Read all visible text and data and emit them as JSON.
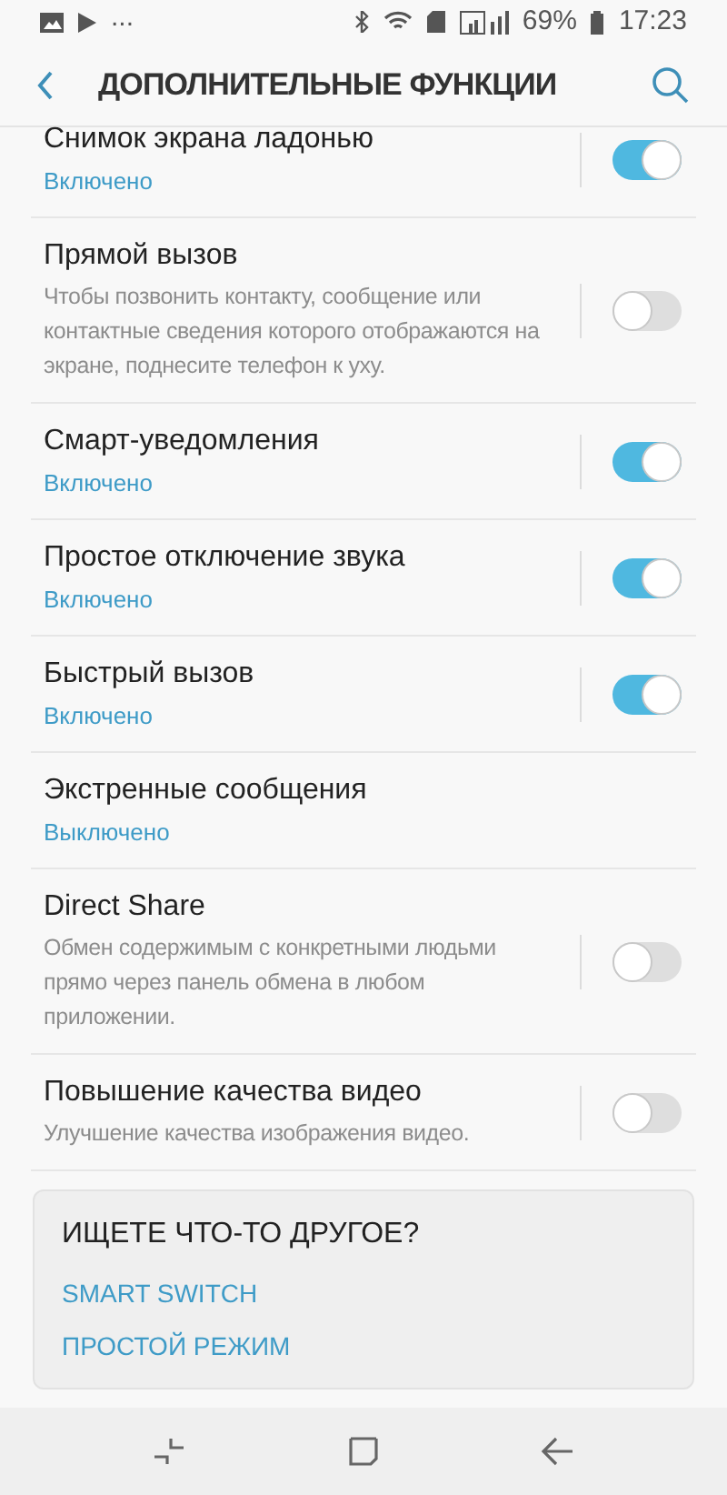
{
  "status_bar": {
    "dots": "...",
    "battery": "69%",
    "time": "17:23"
  },
  "header": {
    "title": "ДОПОЛНИТЕЛЬНЫЕ ФУНКЦИИ"
  },
  "settings": [
    {
      "title": "Снимок экрана ладонью",
      "subtitle": "Включено",
      "kind": "status",
      "on": true
    },
    {
      "title": "Прямой вызов",
      "subtitle": "Чтобы позвонить контакту, сообщение или контактные сведения которого отображаются на экране, поднесите телефон к уху.",
      "kind": "description",
      "on": false
    },
    {
      "title": "Смарт-уведомления",
      "subtitle": "Включено",
      "kind": "status",
      "on": true
    },
    {
      "title": "Простое отключение звука",
      "subtitle": "Включено",
      "kind": "status",
      "on": true
    },
    {
      "title": "Быстрый вызов",
      "subtitle": "Включено",
      "kind": "status",
      "on": true
    },
    {
      "title": "Экстренные сообщения",
      "subtitle": "Выключено",
      "kind": "status_only"
    },
    {
      "title": "Direct Share",
      "subtitle": "Обмен содержимым с конкретными людьми прямо через панель обмена в любом приложении.",
      "kind": "description",
      "on": false
    },
    {
      "title": "Повышение качества видео",
      "subtitle": "Улучшение качества изображения видео.",
      "kind": "description",
      "on": false
    }
  ],
  "suggestions": {
    "title": "ИЩЕТЕ ЧТО-ТО ДРУГОЕ?",
    "links": [
      "SMART SWITCH",
      "ПРОСТОЙ РЕЖИМ"
    ]
  }
}
